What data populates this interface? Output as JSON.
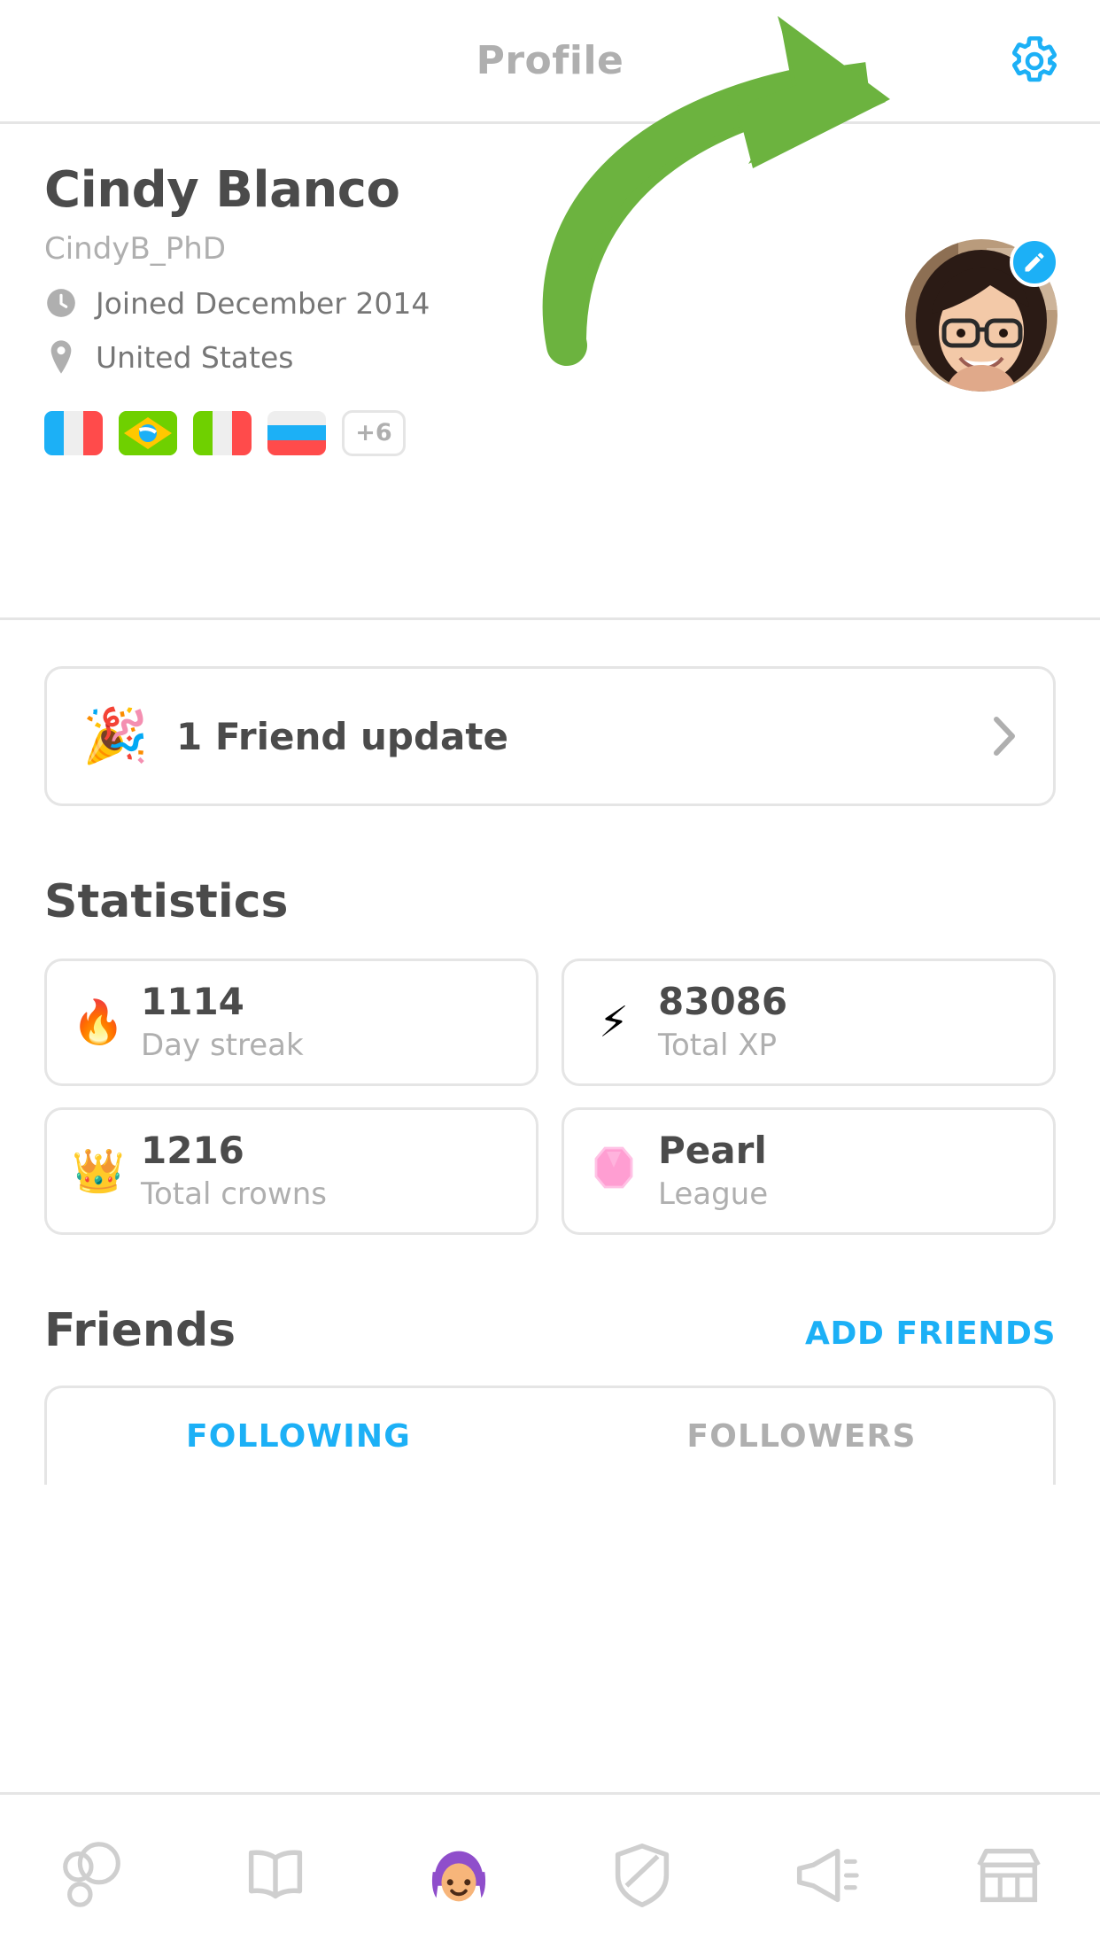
{
  "header": {
    "title": "Profile",
    "settings_icon": "gear-icon"
  },
  "annotation": {
    "type": "curved-arrow",
    "color": "#6cb33f",
    "points_to": "settings-gear-button"
  },
  "profile": {
    "display_name": "Cindy Blanco",
    "username": "CindyB_PhD",
    "joined": "Joined December 2014",
    "joined_icon": "clock-icon",
    "location": "United States",
    "location_icon": "map-pin-icon",
    "avatar_alt": "profile-photo",
    "edit_icon": "pencil-icon",
    "flags": [
      {
        "name": "france-flag",
        "type": "vertical",
        "colors": [
          "#1cb0f6",
          "#eeeeee",
          "#ff4b4b"
        ]
      },
      {
        "name": "brazil-flag",
        "type": "brazil",
        "colors": [
          "#6fd000",
          "#ffc800",
          "#1cb0f6"
        ]
      },
      {
        "name": "italy-flag",
        "type": "vertical",
        "colors": [
          "#6fd000",
          "#eeeeee",
          "#ff4b4b"
        ]
      },
      {
        "name": "russia-flag",
        "type": "horizontal",
        "colors": [
          "#eeeeee",
          "#1cb0f6",
          "#ff4b4b"
        ]
      }
    ],
    "more_flags_badge": "+6"
  },
  "friend_update": {
    "emoji": "🎉",
    "emoji_name": "party-popper-icon",
    "text": "1 Friend update",
    "chevron": "chevron-right-icon"
  },
  "statistics": {
    "title": "Statistics",
    "cards": [
      {
        "icon_name": "fire-icon",
        "emoji": "🔥",
        "value": "1114",
        "label": "Day streak"
      },
      {
        "icon_name": "lightning-bolt-icon",
        "emoji": "⚡",
        "value": "83086",
        "label": "Total XP"
      },
      {
        "icon_name": "crown-icon",
        "emoji": "👑",
        "value": "1216",
        "label": "Total crowns"
      },
      {
        "icon_name": "gem-icon",
        "emoji": "💎",
        "value": "Pearl",
        "label": "League"
      }
    ]
  },
  "friends": {
    "title": "Friends",
    "add_friends_label": "ADD FRIENDS",
    "tabs": [
      {
        "label": "FOLLOWING",
        "active": true
      },
      {
        "label": "FOLLOWERS",
        "active": false
      }
    ]
  },
  "bottom_nav": {
    "items": [
      {
        "name": "learn-icon",
        "label": ""
      },
      {
        "name": "stories-book-icon",
        "label": ""
      },
      {
        "name": "profile-avatar-icon",
        "label": ""
      },
      {
        "name": "leagues-shield-icon",
        "label": ""
      },
      {
        "name": "megaphone-icon",
        "label": ""
      },
      {
        "name": "shop-store-icon",
        "label": ""
      }
    ]
  },
  "colors": {
    "accent_blue": "#1cb0f6",
    "text_dark": "#4b4b4b",
    "text_muted": "#afafaf",
    "border": "#e5e5e5",
    "annotation_green": "#6cb33f"
  }
}
